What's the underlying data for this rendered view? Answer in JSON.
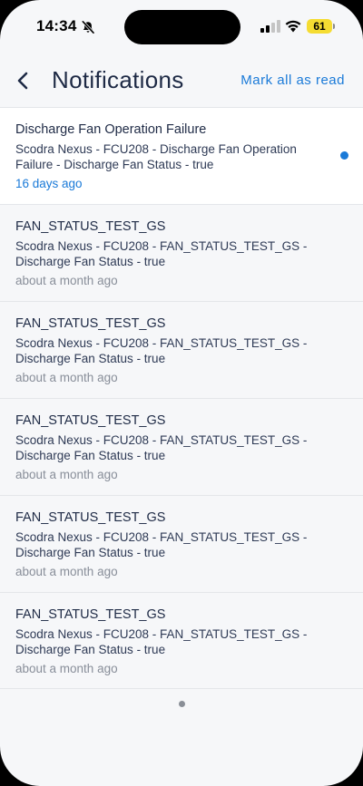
{
  "status_bar": {
    "time": "14:34",
    "battery": "61",
    "icons": [
      "bell-slash-icon",
      "cellular-signal-icon",
      "wifi-icon",
      "battery-icon"
    ]
  },
  "header": {
    "back_icon": "chevron-left-icon",
    "title": "Notifications",
    "mark_all_label": "Mark all as read"
  },
  "colors": {
    "accent": "#1a7ad8",
    "title_text": "#1e2a45",
    "muted_text": "#888e99",
    "unread_bg": "#ffffff",
    "read_bg": "#f6f7f9",
    "battery": "#f5dc32"
  },
  "notifications": [
    {
      "title": "Discharge Fan Operation Failure",
      "body": "Scodra Nexus - FCU208 - Discharge Fan Operation Failure - Discharge Fan Status - true",
      "time": "16 days ago",
      "unread": true
    },
    {
      "title": "FAN_STATUS_TEST_GS",
      "body": "Scodra Nexus - FCU208 - FAN_STATUS_TEST_GS - Discharge Fan Status - true",
      "time": "about a month ago",
      "unread": false
    },
    {
      "title": "FAN_STATUS_TEST_GS",
      "body": "Scodra Nexus - FCU208 - FAN_STATUS_TEST_GS - Discharge Fan Status - true",
      "time": "about a month ago",
      "unread": false
    },
    {
      "title": "FAN_STATUS_TEST_GS",
      "body": "Scodra Nexus - FCU208 - FAN_STATUS_TEST_GS - Discharge Fan Status - true",
      "time": "about a month ago",
      "unread": false
    },
    {
      "title": "FAN_STATUS_TEST_GS",
      "body": "Scodra Nexus - FCU208 - FAN_STATUS_TEST_GS - Discharge Fan Status - true",
      "time": "about a month ago",
      "unread": false
    },
    {
      "title": "FAN_STATUS_TEST_GS",
      "body": "Scodra Nexus - FCU208 - FAN_STATUS_TEST_GS - Discharge Fan Status - true",
      "time": "about a month ago",
      "unread": false
    }
  ]
}
